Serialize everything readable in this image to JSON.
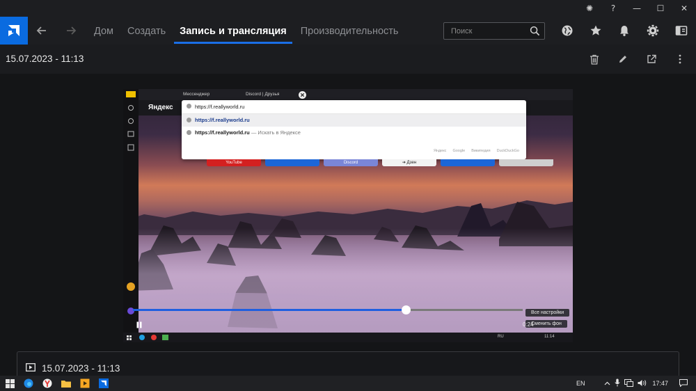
{
  "window": {
    "controls": [
      "bug-icon",
      "help-icon",
      "minimize",
      "maximize",
      "close"
    ],
    "control_glyphs": [
      "✺",
      "?",
      "—",
      "☐",
      "✕"
    ]
  },
  "nav": {
    "tabs": [
      {
        "label": "Дом",
        "active": false
      },
      {
        "label": "Создать",
        "active": false
      },
      {
        "label": "Запись и трансляция",
        "active": true
      },
      {
        "label": "Производительность",
        "active": false
      }
    ],
    "search_placeholder": "Поиск",
    "icons": [
      "globe-icon",
      "star-icon",
      "bell-icon",
      "gear-icon",
      "panel-icon"
    ],
    "accent": "#1a6fe6"
  },
  "subbar": {
    "date": "15.07.2023 - 11:13",
    "icons": [
      "trash-icon",
      "edit-icon",
      "share-icon",
      "more-icon"
    ]
  },
  "recording": {
    "browser_tabs": [
      "Мессенджер",
      "Discord | Друзья"
    ],
    "yandex_label": "Яндекс",
    "address_text": "https://f.reallyworld.ru",
    "suggestions": [
      {
        "url": "https://f.reallyworld.ru",
        "hint": ""
      },
      {
        "url": "https://f.reallyworld.ru",
        "hint": " — Искать в Яндексе"
      }
    ],
    "engines": [
      "Яндекс",
      "Google",
      "Википедия",
      "DuckDuckGo"
    ],
    "tiles": [
      {
        "label": "YouTube",
        "color": "#d42020"
      },
      {
        "label": "",
        "color": "#1c66d8"
      },
      {
        "label": "Discord",
        "color": "#7a86d8"
      },
      {
        "label": "➔ Дзен",
        "color": "#f2f2f2"
      },
      {
        "label": "",
        "color": "#1c66d8"
      },
      {
        "label": "",
        "color": "#cfcfcf"
      }
    ],
    "settings_button": "Все настройки",
    "background_button": "Сменить фон",
    "timecode": "0:24",
    "progress": 0.7,
    "inner_taskbar_lang": "RU",
    "inner_taskbar_time": "11:14"
  },
  "bottom_panel": {
    "title": "15.07.2023 - 11:13"
  },
  "taskbar": {
    "lang": "EN",
    "time": "17:47"
  }
}
